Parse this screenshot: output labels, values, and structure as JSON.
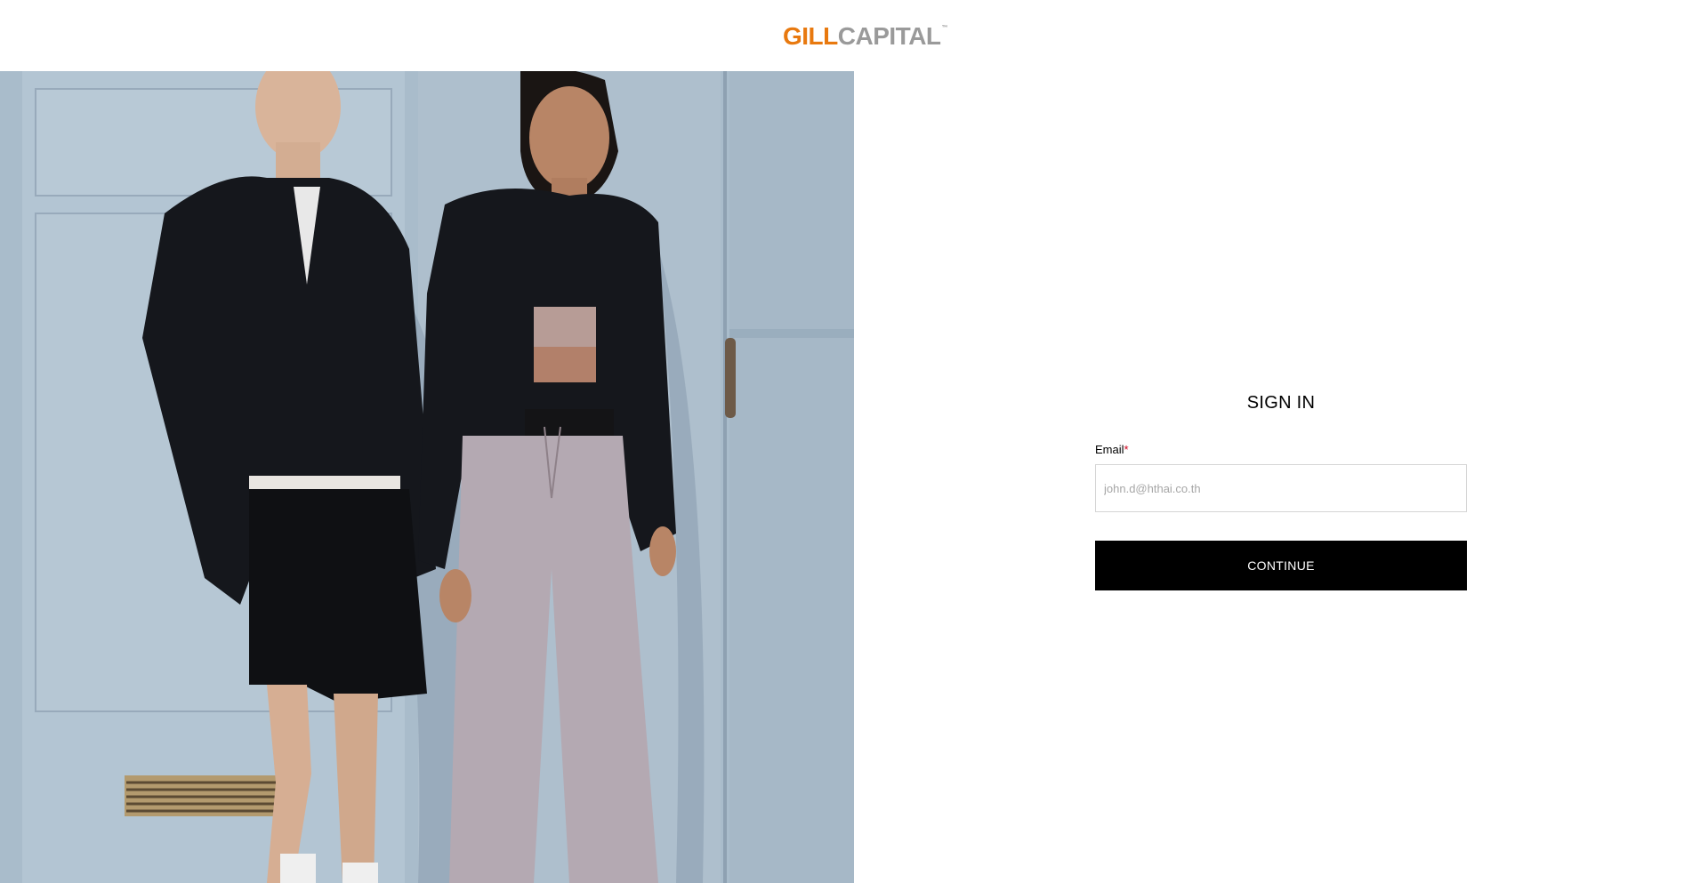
{
  "brand": {
    "logo_part1": "GILL",
    "logo_part2": "CAPITAL",
    "logo_tm": "™",
    "logo_colors": {
      "gill": "#e8790f",
      "capital": "#9a9a9a"
    }
  },
  "hero": {
    "icon": "fashion-photo-image",
    "colors": {
      "wall": "#a9bccb",
      "garment": "#15171c",
      "pants": "#b4a9b2"
    }
  },
  "signin": {
    "title": "SIGN IN",
    "email_label": "Email",
    "required_marker": "*",
    "email_placeholder": "john.d@hthai.co.th",
    "email_value": "",
    "continue_label": "CONTINUE",
    "button_color": "#000000"
  }
}
